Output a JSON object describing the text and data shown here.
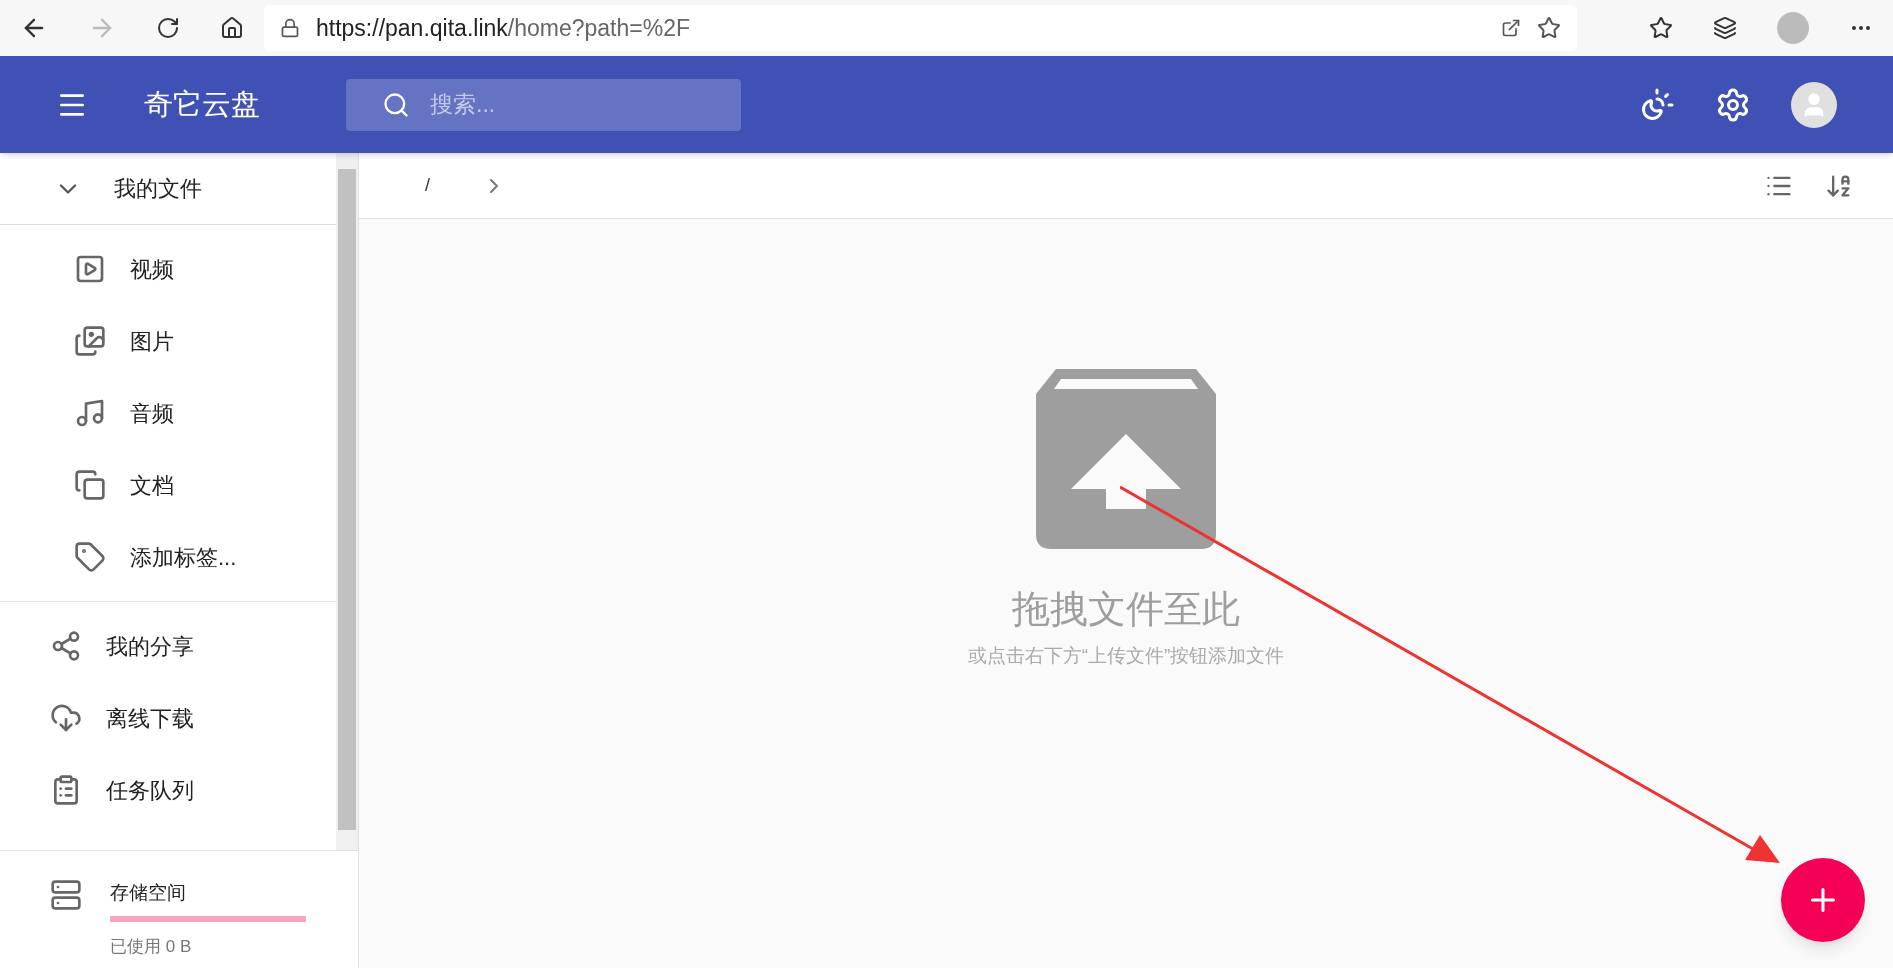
{
  "browser": {
    "url_host": "https://pan.qita.link",
    "url_path": "/home?path=%2F"
  },
  "app_bar": {
    "title": "奇它云盘",
    "search": {
      "placeholder": "搜索..."
    }
  },
  "sidebar": {
    "my_files": {
      "label": "我的文件",
      "expanded": true,
      "children": [
        {
          "label": "视频",
          "kind": "video"
        },
        {
          "label": "图片",
          "kind": "image"
        },
        {
          "label": "音频",
          "kind": "audio"
        },
        {
          "label": "文档",
          "kind": "doc"
        },
        {
          "label": "添加标签...",
          "kind": "tag"
        }
      ]
    },
    "items": [
      {
        "label": "我的分享",
        "kind": "share"
      },
      {
        "label": "离线下载",
        "kind": "download"
      },
      {
        "label": "任务队列",
        "kind": "tasks"
      }
    ],
    "storage": {
      "label": "存储空间",
      "level": 0,
      "reading": "已使用 0 B"
    }
  },
  "breadcrumb": {
    "path": "/"
  },
  "empty_state": {
    "title": "拖拽文件至此",
    "hint": "或点击右下方“上传文件”按钮添加文件"
  }
}
